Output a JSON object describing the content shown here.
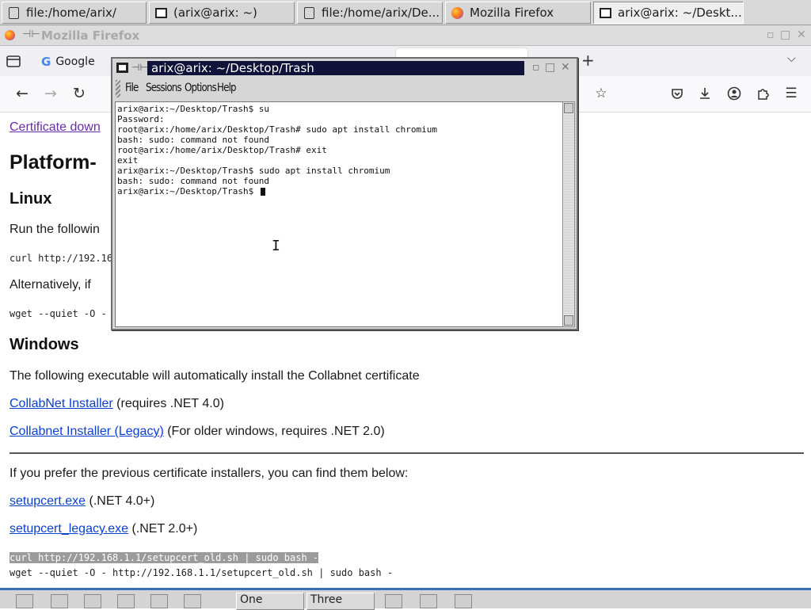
{
  "taskbar": {
    "tasks": [
      {
        "label": "file:/home/arix/",
        "icon": "document-icon"
      },
      {
        "label": "(arix@arix: ~)",
        "icon": "terminal-icon"
      },
      {
        "label": "file:/home/arix/De...",
        "icon": "document-icon"
      },
      {
        "label": "Mozilla Firefox",
        "icon": "firefox-icon"
      },
      {
        "label": "arix@arix: ~/Deskt...",
        "icon": "terminal-icon"
      }
    ]
  },
  "firefox": {
    "window_title": "Mozilla Firefox",
    "tab1_label": "Google",
    "tab1_icon_letter": "G"
  },
  "page": {
    "cert_link": "Certificate down",
    "heading_platform": "Platform-",
    "heading_linux": "Linux",
    "run_following": "Run the followin",
    "curl_cmd": "curl http://192.16",
    "alternatively": "Alternatively, if",
    "wget_cmd": "wget --quiet -O -",
    "heading_windows": "Windows",
    "windows_desc": "The following executable will automatically install the Collabnet certificate",
    "collabnet_installer": "CollabNet Installer",
    "collabnet_installer_note": " (requires .NET 4.0)",
    "collabnet_legacy": "Collabnet Installer (Legacy)",
    "collabnet_legacy_note": " (For older windows, requires .NET 2.0)",
    "prefer_previous": "If you prefer the previous certificate installers, you can find them below:",
    "setupcert": "setupcert.exe",
    "setupcert_note": " (.NET 4.0+)",
    "setupcert_legacy": "setupcert_legacy.exe",
    "setupcert_legacy_note": " (.NET 2.0+)",
    "curl_old": "curl http://192.168.1.1/setupcert_old.sh | sudo bash -",
    "wget_old": "wget --quiet -O - http://192.168.1.1/setupcert_old.sh | sudo bash -"
  },
  "konsole": {
    "title": "arix@arix: ~/Desktop/Trash",
    "menu": [
      "File",
      "Sessions",
      "Options",
      "Help"
    ],
    "lines": [
      "arix@arix:~/Desktop/Trash$ su",
      "Password:",
      "root@arix:/home/arix/Desktop/Trash# sudo apt install chromium",
      "bash: sudo: command not found",
      "root@arix:/home/arix/Desktop/Trash# exit",
      "exit",
      "arix@arix:~/Desktop/Trash$ sudo apt install chromium",
      "bash: sudo: command not found",
      "arix@arix:~/Desktop/Trash$ "
    ]
  },
  "bottompanel": {
    "desktops": [
      "One",
      "Three"
    ]
  }
}
